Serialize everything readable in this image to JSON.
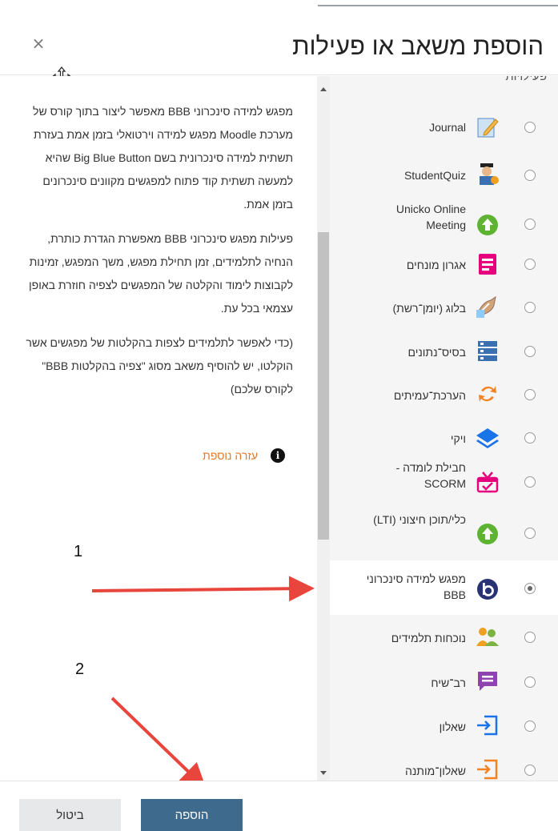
{
  "modal": {
    "title": "הוספת משאב או פעילות",
    "close_label": "×"
  },
  "list": {
    "header": "פעילויות",
    "items": [
      {
        "label": "Journal",
        "icon": "journal-icon",
        "selected": false
      },
      {
        "label": "StudentQuiz",
        "icon": "studentquiz-icon",
        "selected": false
      },
      {
        "label": "Unicko Online Meeting",
        "icon": "unicko-icon",
        "selected": false
      },
      {
        "label": "אגרון מונחים",
        "icon": "glossary-icon",
        "selected": false
      },
      {
        "label": "בלוג (יומן־רשת)",
        "icon": "blog-icon",
        "selected": false
      },
      {
        "label": "בסיס־נתונים",
        "icon": "database-icon",
        "selected": false
      },
      {
        "label": "הערכת־עמיתים",
        "icon": "workshop-icon",
        "selected": false
      },
      {
        "label": "ויקי",
        "icon": "wiki-icon",
        "selected": false
      },
      {
        "label": "חבילת לומדה - SCORM",
        "icon": "scorm-icon",
        "selected": false
      },
      {
        "label": "כלי/תוכן חיצוני (LTI)",
        "icon": "lti-icon",
        "selected": false
      },
      {
        "label": "מפגש למידה סינכרוני BBB",
        "icon": "bigbluebutton-icon",
        "selected": true
      },
      {
        "label": "נוכחות תלמידים",
        "icon": "attendance-icon",
        "selected": false
      },
      {
        "label": "רב־שיח",
        "icon": "chat-icon",
        "selected": false
      },
      {
        "label": "שאלון",
        "icon": "quiz-icon",
        "selected": false
      },
      {
        "label": "שאלון־מותנה",
        "icon": "conditional-quiz-icon",
        "selected": false
      }
    ]
  },
  "description": {
    "paragraph1": "מפגש למידה סינכרוני BBB מאפשר ליצור בתוך קורס של מערכת Moodle מפגש למידה וירטואלי בזמן אמת בעזרת תשתית למידה סינכרונית בשם Big Blue Button שהיא למעשה תשתית קוד פתוח למפגשים מקוונים סינכרונים בזמן אמת.",
    "paragraph2": "פעילות מפגש סינכרוני BBB מאפשרת הגדרת כותרת, הנחיה לתלמידים, זמן תחילת מפגש, משך המפגש, זמינות לקבוצות לימוד והקלטה של המפגשים לצפיה חוזרת באופן עצמאי בכל עת.",
    "paragraph3": "(כדי לאפשר לתלמידים לצפות בהקלטות של מפגשים אשר הוקלטו, יש להוסיף משאב מסוג \"צפיה בהקלטות BBB\" לקורס שלכם)",
    "help_link": "עזרה נוספת"
  },
  "annotations": {
    "step1": "1",
    "step2": "2",
    "arrow_color": "#e8453c"
  },
  "footer": {
    "add_label": "הוספה",
    "cancel_label": "ביטול"
  },
  "colors": {
    "primary_button": "#3e6a8d",
    "help_link": "#e87722",
    "list_background": "#f5f5f5"
  }
}
